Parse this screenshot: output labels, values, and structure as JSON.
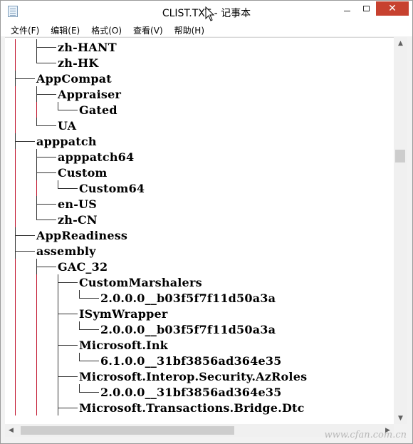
{
  "window": {
    "title": "CLIST.TXT - 记事本",
    "buttons": {
      "minimize": "—",
      "maximize": "☐",
      "close": "✕"
    }
  },
  "menu": [
    "文件(F)",
    "编辑(E)",
    "格式(O)",
    "查看(V)",
    "帮助(H)"
  ],
  "lines": [
    {
      "text": "zh-HANT",
      "depth": 2,
      "last": false
    },
    {
      "text": "zh-HK",
      "depth": 2,
      "last": true
    },
    {
      "text": "AppCompat",
      "depth": 1,
      "last": false
    },
    {
      "text": "Appraiser",
      "depth": 2,
      "last": false
    },
    {
      "text": "Gated",
      "depth": 3,
      "last": true
    },
    {
      "text": "UA",
      "depth": 2,
      "last": true
    },
    {
      "text": "apppatch",
      "depth": 1,
      "last": false
    },
    {
      "text": "apppatch64",
      "depth": 2,
      "last": false
    },
    {
      "text": "Custom",
      "depth": 2,
      "last": false
    },
    {
      "text": "Custom64",
      "depth": 3,
      "last": true
    },
    {
      "text": "en-US",
      "depth": 2,
      "last": false
    },
    {
      "text": "zh-CN",
      "depth": 2,
      "last": true
    },
    {
      "text": "AppReadiness",
      "depth": 1,
      "last": false
    },
    {
      "text": "assembly",
      "depth": 1,
      "last": false
    },
    {
      "text": "GAC_32",
      "depth": 2,
      "last": false
    },
    {
      "text": "CustomMarshalers",
      "depth": 3,
      "last": false
    },
    {
      "text": "2.0.0.0__b03f5f7f11d50a3a",
      "depth": 4,
      "last": true
    },
    {
      "text": "ISymWrapper",
      "depth": 3,
      "last": false
    },
    {
      "text": "2.0.0.0__b03f5f7f11d50a3a",
      "depth": 4,
      "last": true
    },
    {
      "text": "Microsoft.Ink",
      "depth": 3,
      "last": false
    },
    {
      "text": "6.1.0.0__31bf3856ad364e35",
      "depth": 4,
      "last": true
    },
    {
      "text": "Microsoft.Interop.Security.AzRoles",
      "depth": 3,
      "last": false
    },
    {
      "text": "2.0.0.0__31bf3856ad364e35",
      "depth": 4,
      "last": true
    },
    {
      "text": "Microsoft.Transactions.Bridge.Dtc",
      "depth": 3,
      "last": false
    }
  ],
  "scrollbar": {
    "up": "▲",
    "down": "▼",
    "left": "◀",
    "right": "▶"
  },
  "watermark": "www.cfan.com.cn",
  "colors": {
    "tree_rule": "#c0102a",
    "close_button": "#c7412f"
  }
}
